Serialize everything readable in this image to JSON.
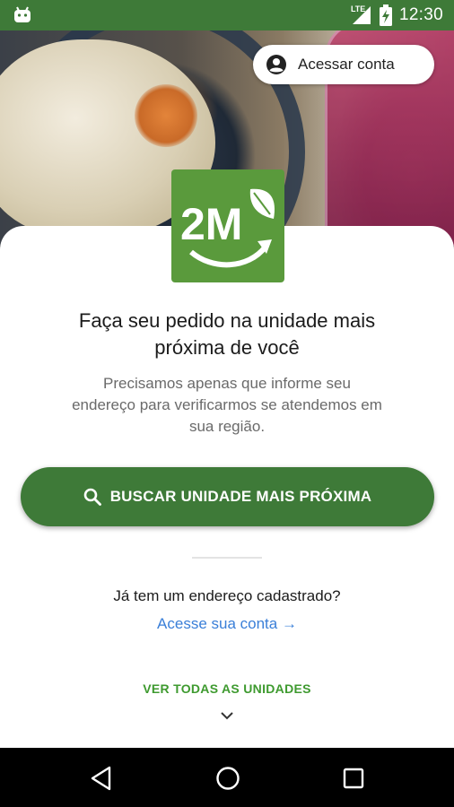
{
  "status_bar": {
    "time": "12:30",
    "network": "LTE",
    "icons": [
      "android-icon",
      "signal-icon",
      "battery-charging-icon"
    ]
  },
  "header": {
    "account_button_label": "Acessar conta",
    "account_icon": "account-circle-icon"
  },
  "brand": {
    "logo_text": "2M",
    "color": "#5a9a3c"
  },
  "main": {
    "headline_line1": "Faça seu pedido na unidade mais",
    "headline_line2": "próxima de você",
    "sub_line1": "Precisamos apenas que informe seu",
    "sub_line2": "endereço para verificarmos se atendemos em",
    "sub_line3": "sua região.",
    "cta_label": "BUSCAR UNIDADE MAIS PRÓXIMA",
    "cta_icon": "search-icon",
    "question": "Já tem um endereço cadastrado?",
    "access_link": "Acesse sua conta →",
    "all_units": "VER TODAS AS UNIDADES",
    "chevron_icon": "chevron-down-icon"
  },
  "nav_bar": {
    "icons": [
      "back-icon",
      "home-icon",
      "recents-icon"
    ]
  },
  "colors": {
    "primary": "#3e7a38",
    "link": "#3a7fd8",
    "accent_text": "#3e9a2f"
  }
}
